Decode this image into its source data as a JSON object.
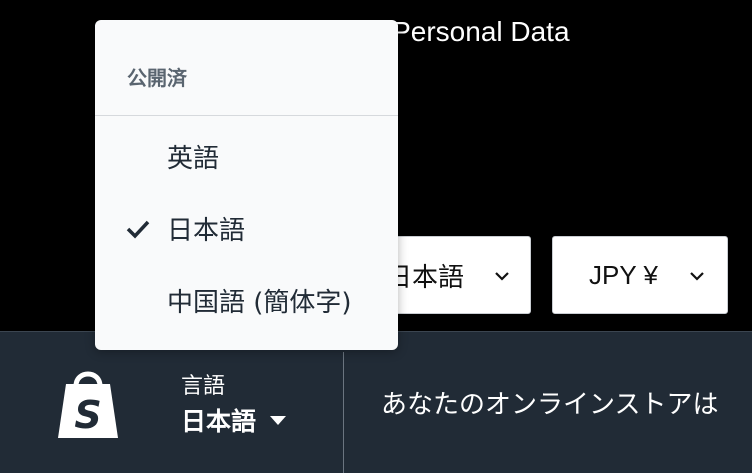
{
  "page_title": "My Personal Data",
  "language_select": {
    "value": "日本語"
  },
  "currency_select": {
    "value": "JPY ¥"
  },
  "language_dropdown": {
    "header": "公開済",
    "items": [
      {
        "label": "英語",
        "selected": false
      },
      {
        "label": "日本語",
        "selected": true
      },
      {
        "label": "中国語 (簡体字)",
        "selected": false
      }
    ]
  },
  "footer_bar": {
    "language_label": "言語",
    "language_current": "日本語",
    "tagline": "あなたのオンラインストアは"
  },
  "colors": {
    "bar_background": "#212b36",
    "logo_green": "#ffffff"
  }
}
